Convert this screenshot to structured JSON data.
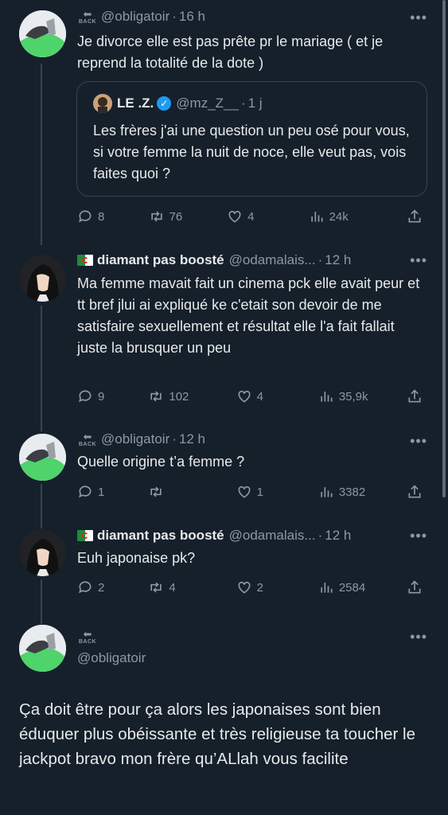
{
  "tweets": [
    {
      "handle": "@obligatoir",
      "time": "16 h",
      "text": "Je divorce elle est pas prête pr le mariage ( et je reprend la totalité de la dote )",
      "quote": {
        "name": "LE .Z.",
        "handle": "@mz_Z__",
        "time": "1 j",
        "text": "Les frères j'ai une question un peu osé pour vous, si votre femme la nuit de noce, elle veut pas, vois faites quoi ?"
      },
      "replies": "8",
      "retweets": "76",
      "likes": "4",
      "views": "24k"
    },
    {
      "name": "diamant pas boosté",
      "handle": "@odamalais...",
      "time": "12 h",
      "text": "Ma femme mavait fait un cinema pck elle avait peur et tt bref jlui ai expliqué ke c'etait son devoir de me satisfaire sexuellement et résultat elle l'a fait fallait juste la brusquer un peu",
      "replies": "9",
      "retweets": "102",
      "likes": "4",
      "views": "35,9k"
    },
    {
      "handle": "@obligatoir",
      "time": "12 h",
      "text": "Quelle origine t’a femme ?",
      "replies": "1",
      "retweets": "",
      "likes": "1",
      "views": "3382"
    },
    {
      "name": "diamant pas boosté",
      "handle": "@odamalais...",
      "time": "12 h",
      "text": "Euh japonaise pk?",
      "replies": "2",
      "retweets": "4",
      "likes": "2",
      "views": "2584"
    },
    {
      "handle": "@obligatoir",
      "text": "Ça doit être pour ça alors les japonaises sont bien éduquer plus obéissante et très religieuse ta toucher le jackpot  bravo mon frère qu’ALlah vous facilite"
    }
  ],
  "common": {
    "dot": "·",
    "more": "•••",
    "back_label": "BACK"
  },
  "icons": [
    "back-logo-icon",
    "verified-icon",
    "reply-icon",
    "retweet-icon",
    "like-icon",
    "views-icon",
    "share-icon",
    "more-icon"
  ],
  "colors": {
    "background": "#15202b",
    "text": "#e7e9ea",
    "muted": "#8b98a5",
    "verified": "#1d9bf0"
  }
}
